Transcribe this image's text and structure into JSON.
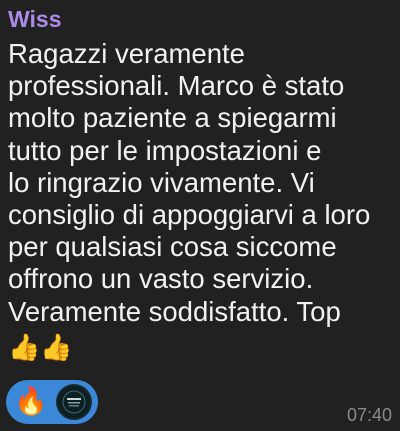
{
  "message": {
    "sender": "Wiss",
    "lines": [
      "Ragazzi veramente",
      "professionali. Marco è stato",
      "molto paziente a spiegarmi",
      "tutto per le impostazioni e",
      "lo ringrazio vivamente. Vi",
      "consiglio di appoggiarvi a loro",
      "per qualsiasi cosa siccome",
      "offrono un vasto servizio.",
      "Veramente soddisfatto. Top"
    ],
    "emoji_line": "👍👍",
    "time": "07:40"
  },
  "reaction": {
    "emoji": "🔥",
    "avatar_icon": "reactor-avatar"
  },
  "colors": {
    "background": "#212121",
    "sender": "#a98ce8",
    "text": "#f2f2f2",
    "reaction_bg": "#3b87d8",
    "time": "#8a8a8a"
  }
}
